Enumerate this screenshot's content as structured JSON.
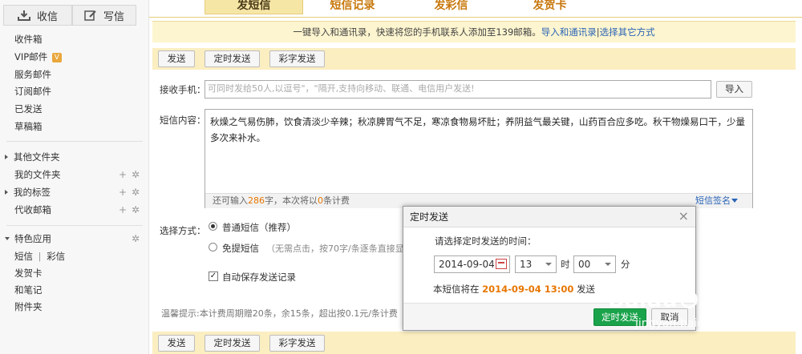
{
  "sidebar": {
    "inbox_btn": "收信",
    "compose_btn": "写信",
    "items": [
      "收件箱",
      "VIP邮件",
      "服务邮件",
      "订阅邮件",
      "已发送",
      "草稿箱"
    ],
    "vip_badge": "V",
    "groups": [
      "其他文件夹",
      "我的文件夹",
      "我的标签",
      "代收邮箱"
    ],
    "features_title": "特色应用",
    "feature_sms": "短信",
    "feature_sep": "|",
    "feature_mms": "彩信",
    "feature_items": [
      "发贺卡",
      "和笔记",
      "附件夹"
    ]
  },
  "tabs": [
    "发短信",
    "短信记录",
    "发彩信",
    "发贺卡"
  ],
  "banner": {
    "text": "一键导入和通讯录，快速将您的手机联系人添加至139邮箱。",
    "link1": "导入和通讯录",
    "sep": "|",
    "link2": "选择其它方式"
  },
  "toolbar": {
    "send": "发送",
    "timed_send": "定时发送",
    "art_send": "彩字发送"
  },
  "form": {
    "recipient_label": "接收手机：",
    "recipient_placeholder": "可同时发给50人,以逗号\"，\"隔开,支持向移动、联通、电信用户发送!",
    "import_btn": "导入",
    "content_label": "短信内容：",
    "content_text": "秋燥之气易伤肺，饮食清淡少辛辣；秋凉脾胃气不足，寒凉食物易坏肚；养阴益气最关键，山药百合应多吃。秋干物燥易口干，少量多次来补水。",
    "counter_prefix": "还可输入",
    "counter_num": "286",
    "counter_mid": "字，本次将以",
    "counter_num2": "0",
    "counter_suffix": "条计费",
    "signature": "短信签名",
    "method_label": "选择方式：",
    "option1": "普通短信（推荐）",
    "option2": "免提短信",
    "option2_note": "（无需点击，按70字/条逐条直接显",
    "save_record": "自动保存发送记录",
    "tip": "温馨提示:本计费周期赠20条，余15条，超出按0.1元/条计费"
  },
  "dialog": {
    "title": "定时发送",
    "close": "×",
    "prompt": "请选择定时发送的时间：",
    "date": "2014-09-04",
    "hour": "13",
    "hour_unit": "时",
    "minute": "00",
    "minute_unit": "分",
    "summary_prefix": "本短信将在",
    "summary_time": "2014-09-04 13:00",
    "summary_suffix": "发送",
    "confirm": "定时发送",
    "cancel": "取消"
  },
  "watermark": {
    "brand": "Baidu",
    "cn": "经验",
    "url": "jingyan.baidu.com"
  }
}
